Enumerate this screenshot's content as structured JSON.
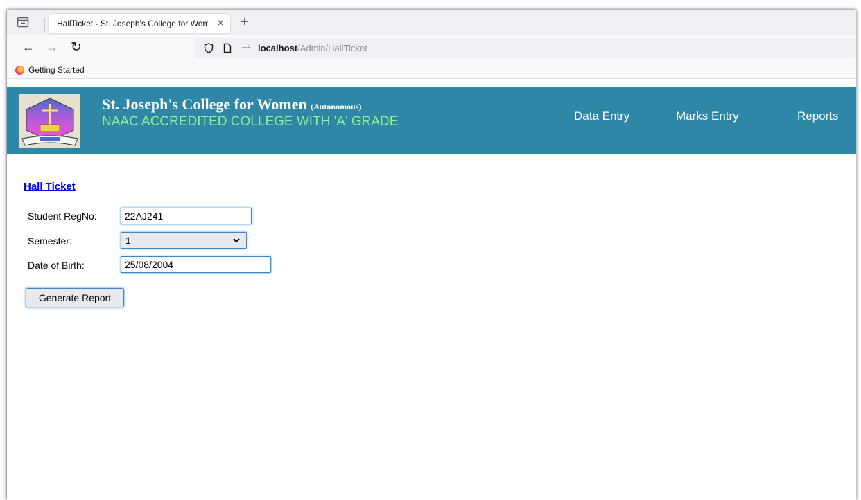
{
  "browser": {
    "tab_title": "HallTicket - St. Joseph's College for Women",
    "tab_close": "✕",
    "new_tab": "+",
    "url_host": "localhost",
    "url_path": "/Admin/HallTicket",
    "bookmark": "Getting Started"
  },
  "header": {
    "college_name": "St. Joseph's College for Women",
    "autonomous": "(Autonomous)",
    "accreditation": "NAAC ACCREDITED COLLEGE WITH 'A' GRADE",
    "nav": [
      "Data Entry",
      "Marks Entry",
      "Reports"
    ],
    "colors": {
      "header_bg": "#2e87a6",
      "accreditation_text": "#90ee90"
    }
  },
  "main": {
    "page_link": "Hall Ticket",
    "form": {
      "regno_label": "Student RegNo:",
      "regno_value": "22AJ241",
      "semester_label": "Semester:",
      "semester_value": "1",
      "dob_label": "Date of Birth:",
      "dob_value": "25/08/2004",
      "submit_label": "Generate Report"
    }
  },
  "icons": [
    "tab-list-icon",
    "back-arrow-icon",
    "forward-arrow-icon",
    "reload-icon",
    "shield-icon",
    "page-icon",
    "permissions-icon",
    "firefox-icon",
    "college-logo",
    "chevron-down-icon"
  ]
}
